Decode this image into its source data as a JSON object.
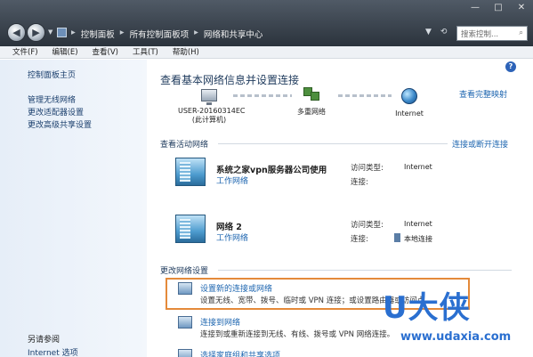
{
  "window": {
    "controls": [
      "—",
      "□",
      "✕"
    ]
  },
  "address": {
    "breadcrumbs": [
      "控制面板",
      "所有控制面板项",
      "网络和共享中心"
    ],
    "search_placeholder": "搜索控制..."
  },
  "menu": [
    "文件(F)",
    "编辑(E)",
    "查看(V)",
    "工具(T)",
    "帮助(H)"
  ],
  "sidebar": {
    "home": "控制面板主页",
    "items": [
      "管理无线网络",
      "更改适配器设置",
      "更改高级共享设置"
    ],
    "see_also": "另请参阅",
    "bottom": "Internet 选项"
  },
  "main": {
    "title": "查看基本网络信息并设置连接",
    "full_map": "查看完整映射",
    "map": {
      "computer_name": "USER-20160314EC",
      "computer_sub": "(此计算机)",
      "middle": "多重网络",
      "internet": "Internet"
    },
    "active_header": "查看活动网络",
    "connect_link": "连接或断开连接",
    "networks": [
      {
        "name": "系统之家vpn服务器公司使用",
        "type": "工作网络",
        "access_label": "访问类型:",
        "access_value": "Internet",
        "conn_label": "连接:",
        "conn_value": ""
      },
      {
        "name": "网络  2",
        "type": "工作网络",
        "access_label": "访问类型:",
        "access_value": "Internet",
        "conn_label": "连接:",
        "conn_value": "本地连接"
      }
    ],
    "change_header": "更改网络设置",
    "tasks": [
      {
        "title": "设置新的连接或网络",
        "desc": "设置无线、宽带、拨号、临时或 VPN 连接；或设置路由器或访问点。"
      },
      {
        "title": "连接到网络",
        "desc": "连接到或重新连接到无线、有线、拨号或 VPN 网络连接。"
      },
      {
        "title": "选择家庭组和共享选项",
        "desc": ""
      }
    ]
  },
  "watermark": {
    "logo": "U大侠",
    "url": "www.udaxia.com"
  }
}
